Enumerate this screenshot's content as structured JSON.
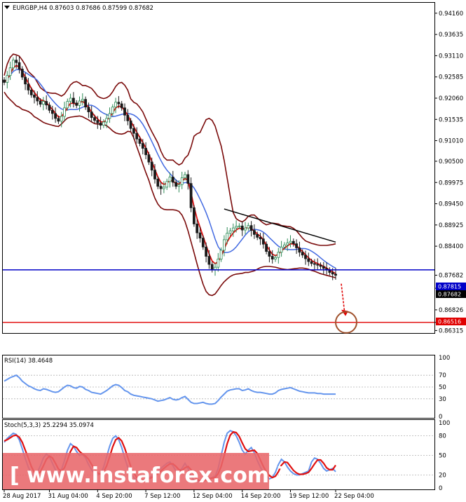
{
  "colors": {
    "candle_up": "#2e8b57",
    "candle_down": "#1a1a1a",
    "bollinger": "#7a0a0a",
    "ema_fast": "#e01010",
    "sma_slow": "#4169e1",
    "support_line": "#0000c8",
    "target_line": "#e00000",
    "trend_line": "#000000",
    "oscillator_blue": "#6495ed",
    "oscillator_red": "#e01010",
    "target_circle": "#a0522d",
    "watermark_bg": "#e8676a",
    "price_label_blue": "#0000c8",
    "price_label_red": "#e00000"
  },
  "main_panel": {
    "header": "EURGBP,H4  0.87603 0.87686 0.87599 0.87682",
    "support_label": "0.87815",
    "current_label": "0.87682",
    "target_label": "0.86516"
  },
  "rsi_panel": {
    "header": "RSI(14) 38.4648",
    "ticks": [
      "100",
      "70",
      "50",
      "30",
      "0"
    ]
  },
  "stoch_panel": {
    "header": "Stoch(5,3,3) 25.2294 35.0974",
    "ticks": [
      "100",
      "80",
      "50",
      "20",
      "0"
    ]
  },
  "watermark": {
    "text": "[  www.instaforex.com  ]"
  },
  "chart_data": [
    {
      "type": "candlestick",
      "title": "EURGBP,H4",
      "ohlc_last": {
        "open": 0.87603,
        "high": 0.87686,
        "low": 0.87599,
        "close": 0.87682
      },
      "y_ticks": [
        "0.94160",
        "0.93635",
        "0.93110",
        "0.92585",
        "0.92060",
        "0.91535",
        "0.91010",
        "0.90500",
        "0.89975",
        "0.89450",
        "0.88925",
        "0.88400",
        "0.87682",
        "0.87360",
        "0.86826",
        "0.86516",
        "0.86315"
      ],
      "ylim": [
        0.8627,
        0.944
      ],
      "x_ticks": [
        "28 Aug 2017",
        "31 Aug 04:00",
        "4 Sep 20:00",
        "7 Sep 12:00",
        "12 Sep 04:00",
        "14 Sep 20:00",
        "19 Sep 12:00",
        "22 Sep 04:00"
      ],
      "x_tick_index": [
        0,
        15,
        31,
        47,
        63,
        79,
        95,
        110
      ],
      "close_series": [
        0.9245,
        0.9262,
        0.9281,
        0.93,
        0.9294,
        0.9278,
        0.9258,
        0.9241,
        0.9226,
        0.9214,
        0.9208,
        0.9199,
        0.9191,
        0.9198,
        0.9189,
        0.9176,
        0.9168,
        0.9156,
        0.9149,
        0.9161,
        0.9182,
        0.9198,
        0.9206,
        0.9194,
        0.9188,
        0.9199,
        0.9203,
        0.9184,
        0.9172,
        0.9158,
        0.9151,
        0.9145,
        0.9139,
        0.9147,
        0.9156,
        0.9168,
        0.9184,
        0.9196,
        0.9192,
        0.9182,
        0.9164,
        0.915,
        0.9131,
        0.9119,
        0.9105,
        0.9094,
        0.9082,
        0.9066,
        0.9048,
        0.9028,
        0.9006,
        0.8988,
        0.8982,
        0.8986,
        0.9,
        0.9011,
        0.8998,
        0.8988,
        0.8992,
        0.9009,
        0.9017,
        0.8995,
        0.8935,
        0.8895,
        0.8873,
        0.886,
        0.8838,
        0.8815,
        0.8795,
        0.8782,
        0.8788,
        0.8808,
        0.883,
        0.8856,
        0.8872,
        0.8878,
        0.8885,
        0.8889,
        0.889,
        0.888,
        0.8885,
        0.8891,
        0.8879,
        0.8869,
        0.8862,
        0.8858,
        0.8845,
        0.8827,
        0.8815,
        0.8808,
        0.8812,
        0.8825,
        0.8838,
        0.8843,
        0.8848,
        0.8852,
        0.8846,
        0.8836,
        0.8825,
        0.8818,
        0.8809,
        0.8802,
        0.8797,
        0.8795,
        0.8793,
        0.879,
        0.8785,
        0.8781,
        0.8775,
        0.8771,
        0.8768
      ],
      "bollinger_upper": [
        0.9262,
        0.929,
        0.9307,
        0.9315,
        0.9313,
        0.931,
        0.93,
        0.9288,
        0.9272,
        0.9265,
        0.9258,
        0.9245,
        0.9232,
        0.9226,
        0.9221,
        0.9219,
        0.9218,
        0.9218,
        0.9215,
        0.9211,
        0.9216,
        0.9227,
        0.9239,
        0.9245,
        0.9247,
        0.9243,
        0.9237,
        0.9237,
        0.9234,
        0.923,
        0.9221,
        0.9211,
        0.9207,
        0.9205,
        0.9207,
        0.9212,
        0.9222,
        0.9235,
        0.9243,
        0.9245,
        0.9238,
        0.9226,
        0.9204,
        0.9196,
        0.9192,
        0.9183,
        0.9172,
        0.9155,
        0.9138,
        0.9123,
        0.9109,
        0.9095,
        0.9075,
        0.906,
        0.9053,
        0.9053,
        0.9053,
        0.9046,
        0.9041,
        0.9045,
        0.9058,
        0.9065,
        0.9085,
        0.9112,
        0.9118,
        0.9121,
        0.9137,
        0.9153,
        0.9156,
        0.9151,
        0.9137,
        0.9112,
        0.9088,
        0.9052,
        0.9008,
        0.8964,
        0.8923,
        0.8908,
        0.8903,
        0.89,
        0.8905,
        0.8914,
        0.8917,
        0.8917,
        0.891,
        0.8903,
        0.8897,
        0.8893,
        0.8895,
        0.8897,
        0.8896,
        0.8895,
        0.8891,
        0.889,
        0.8889,
        0.8888,
        0.8884,
        0.8878,
        0.8869,
        0.886,
        0.8853,
        0.885,
        0.8847,
        0.8845,
        0.8843,
        0.8842,
        0.8842,
        0.8842,
        0.8843,
        0.8844,
        0.8846
      ],
      "bollinger_lower": [
        0.9221,
        0.921,
        0.9202,
        0.9195,
        0.9187,
        0.9184,
        0.9178,
        0.9176,
        0.9173,
        0.9168,
        0.916,
        0.9156,
        0.9151,
        0.9146,
        0.9143,
        0.9141,
        0.9139,
        0.9137,
        0.9136,
        0.9142,
        0.915,
        0.9157,
        0.9159,
        0.916,
        0.9161,
        0.9162,
        0.916,
        0.9156,
        0.9152,
        0.9147,
        0.9143,
        0.9142,
        0.9142,
        0.9141,
        0.9138,
        0.9132,
        0.9125,
        0.912,
        0.9118,
        0.9117,
        0.9119,
        0.9124,
        0.9123,
        0.9108,
        0.9086,
        0.9065,
        0.9043,
        0.9022,
        0.9003,
        0.8979,
        0.8959,
        0.8944,
        0.8935,
        0.8931,
        0.893,
        0.893,
        0.893,
        0.8929,
        0.8926,
        0.8917,
        0.8901,
        0.8878,
        0.8851,
        0.8824,
        0.8796,
        0.877,
        0.8746,
        0.8728,
        0.872,
        0.8718,
        0.8722,
        0.8732,
        0.8743,
        0.8752,
        0.8759,
        0.8765,
        0.8769,
        0.8771,
        0.8772,
        0.8773,
        0.8775,
        0.8775,
        0.8777,
        0.8779,
        0.8783,
        0.8787,
        0.8789,
        0.879,
        0.879,
        0.8789,
        0.8788,
        0.8786,
        0.8784,
        0.8783,
        0.8782,
        0.8783,
        0.8784,
        0.8785,
        0.8786,
        0.8786,
        0.8785,
        0.8783,
        0.878,
        0.8778,
        0.8775,
        0.8772,
        0.877,
        0.8768,
        0.8766,
        0.8764,
        0.8762
      ],
      "support_level": 0.87815,
      "target_level": 0.86516,
      "trend_line": {
        "from_index": 73,
        "from_price": 0.8932,
        "to_index": 110,
        "to_price": 0.885
      }
    },
    {
      "type": "line",
      "title": "RSI(14) 38.4648",
      "ylim": [
        0,
        100
      ],
      "levels": [
        70,
        50,
        30
      ],
      "series": [
        {
          "values": [
            60,
            63,
            66,
            68,
            70,
            66,
            60,
            56,
            52,
            50,
            47,
            45,
            44,
            47,
            46,
            44,
            42,
            41,
            42,
            46,
            50,
            53,
            52,
            49,
            48,
            51,
            50,
            46,
            44,
            41,
            40,
            39,
            38,
            41,
            44,
            48,
            52,
            54,
            53,
            49,
            44,
            42,
            38,
            36,
            35,
            34,
            33,
            32,
            31,
            30,
            28,
            26,
            27,
            28,
            30,
            32,
            29,
            28,
            29,
            32,
            34,
            29,
            24,
            22,
            22,
            23,
            24,
            22,
            21,
            21,
            22,
            27,
            33,
            38,
            43,
            45,
            46,
            47,
            47,
            44,
            45,
            47,
            44,
            42,
            41,
            41,
            40,
            39,
            38,
            38,
            40,
            44,
            46,
            47,
            48,
            49,
            47,
            45,
            43,
            42,
            41,
            40,
            40,
            40,
            39,
            39,
            38,
            38,
            38,
            38,
            38
          ]
        }
      ]
    },
    {
      "type": "line",
      "title": "Stoch(5,3,3) 25.2294 35.0974",
      "ylim": [
        0,
        100
      ],
      "levels": [
        80,
        50,
        20
      ],
      "series": [
        {
          "name": "main",
          "values": [
            70,
            76,
            80,
            84,
            82,
            74,
            60,
            45,
            32,
            22,
            18,
            24,
            34,
            46,
            52,
            48,
            38,
            28,
            22,
            28,
            42,
            58,
            68,
            64,
            56,
            50,
            52,
            46,
            36,
            28,
            22,
            20,
            22,
            32,
            48,
            64,
            76,
            80,
            74,
            62,
            46,
            32,
            22,
            16,
            12,
            12,
            12,
            14,
            16,
            18,
            22,
            26,
            30,
            34,
            38,
            40,
            34,
            26,
            24,
            30,
            38,
            30,
            18,
            12,
            10,
            10,
            12,
            14,
            15,
            16,
            18,
            30,
            50,
            70,
            84,
            88,
            86,
            80,
            70,
            58,
            52,
            58,
            62,
            54,
            42,
            32,
            24,
            18,
            14,
            16,
            24,
            36,
            44,
            40,
            32,
            26,
            22,
            20,
            20,
            22,
            24,
            26,
            40,
            46,
            44,
            38,
            30,
            26,
            28,
            30,
            25
          ]
        },
        {
          "name": "signal",
          "values": [
            72,
            74,
            77,
            80,
            81,
            78,
            70,
            58,
            46,
            33,
            24,
            21,
            25,
            34,
            44,
            49,
            46,
            38,
            29,
            26,
            31,
            43,
            56,
            64,
            62,
            56,
            52,
            49,
            44,
            36,
            29,
            23,
            21,
            25,
            34,
            48,
            63,
            74,
            77,
            72,
            61,
            47,
            33,
            23,
            16,
            13,
            12,
            12,
            14,
            16,
            19,
            22,
            26,
            30,
            34,
            37,
            37,
            33,
            28,
            27,
            31,
            33,
            28,
            20,
            13,
            11,
            11,
            12,
            14,
            15,
            16,
            22,
            33,
            50,
            68,
            81,
            86,
            85,
            79,
            69,
            60,
            56,
            57,
            58,
            53,
            43,
            33,
            25,
            19,
            16,
            18,
            25,
            35,
            40,
            39,
            33,
            27,
            23,
            21,
            21,
            22,
            24,
            30,
            37,
            43,
            43,
            38,
            31,
            28,
            28,
            35
          ]
        }
      ]
    }
  ]
}
